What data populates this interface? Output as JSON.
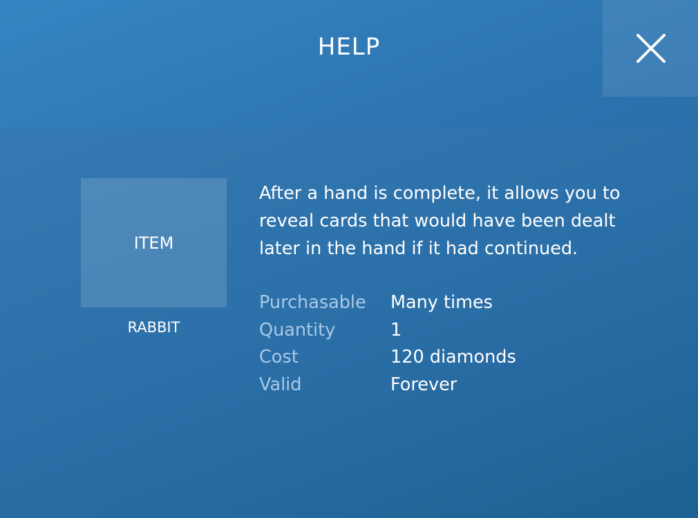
{
  "header": {
    "title": "HELP",
    "close_icon": "close-icon"
  },
  "item": {
    "box_label": "ITEM",
    "name": "RABBIT"
  },
  "description": "After a hand is complete, it allows you to reveal cards that would have been dealt later in the hand if it had continued.",
  "details": [
    {
      "label": "Purchasable",
      "value": "Many times"
    },
    {
      "label": "Quantity",
      "value": "1"
    },
    {
      "label": "Cost",
      "value": "120 diamonds"
    },
    {
      "label": "Valid",
      "value": "Forever"
    }
  ],
  "colors": {
    "background": "#2b70aa",
    "label_text": "#a9c9e6",
    "text": "#ffffff"
  }
}
